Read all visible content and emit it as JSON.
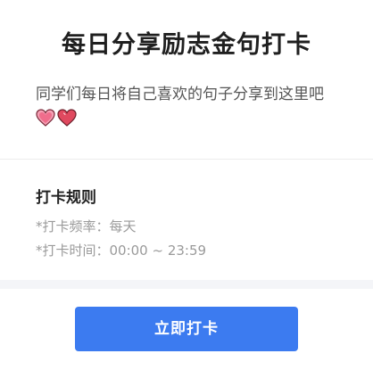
{
  "header": {
    "title": "每日分享励志金句打卡",
    "description": "同学们每日将自己喜欢的句子分享到这里吧"
  },
  "rules": {
    "title": "打卡规则",
    "frequency": "*打卡频率：每天",
    "time": "*打卡时间：00:00 ~ 23:59"
  },
  "action": {
    "checkin_label": "立即打卡"
  },
  "colors": {
    "accent": "#3c7bf0",
    "heart_pink": "#f06d8c",
    "heart_red": "#e0495f"
  },
  "icons": [
    "heart-icon",
    "heart-icon"
  ]
}
